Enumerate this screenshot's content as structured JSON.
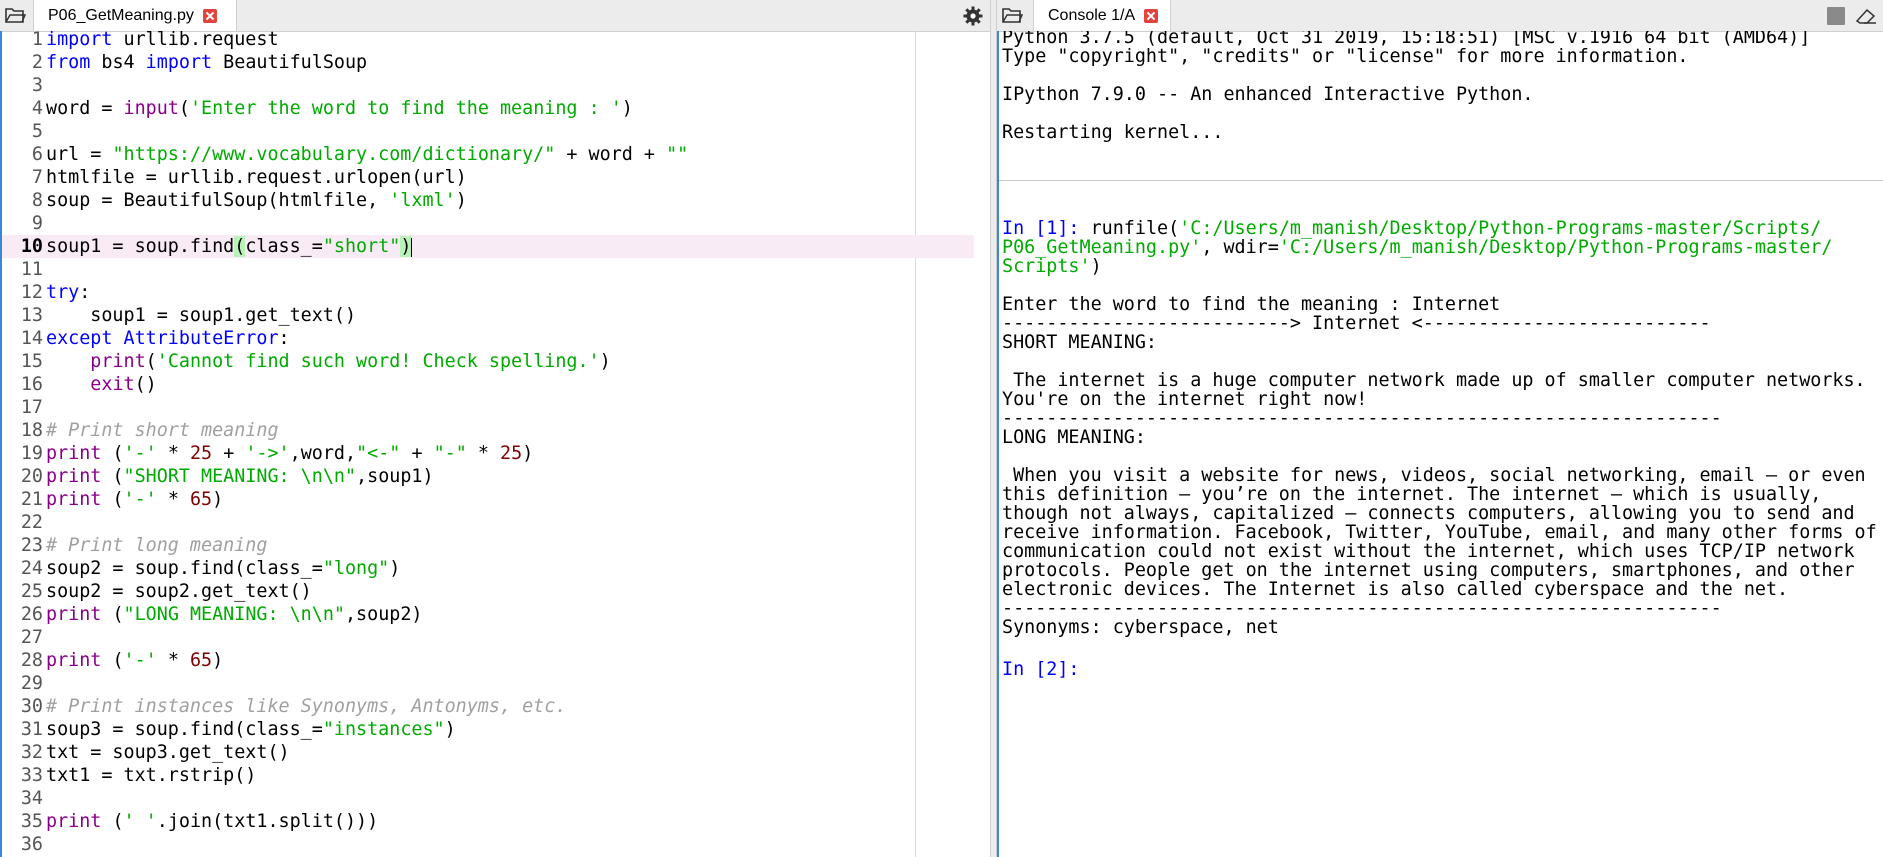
{
  "editor": {
    "tab_label": "P06_GetMeaning.py",
    "current_line": 10,
    "lines": [
      {
        "n": "1"
      },
      {
        "n": "2"
      },
      {
        "n": "3"
      },
      {
        "n": "4"
      },
      {
        "n": "5"
      },
      {
        "n": "6"
      },
      {
        "n": "7"
      },
      {
        "n": "8"
      },
      {
        "n": "9"
      },
      {
        "n": "10"
      },
      {
        "n": "11"
      },
      {
        "n": "12"
      },
      {
        "n": "13"
      },
      {
        "n": "14"
      },
      {
        "n": "15"
      },
      {
        "n": "16"
      },
      {
        "n": "17"
      },
      {
        "n": "18"
      },
      {
        "n": "19"
      },
      {
        "n": "20"
      },
      {
        "n": "21"
      },
      {
        "n": "22"
      },
      {
        "n": "23"
      },
      {
        "n": "24"
      },
      {
        "n": "25"
      },
      {
        "n": "26"
      },
      {
        "n": "27"
      },
      {
        "n": "28"
      },
      {
        "n": "29"
      },
      {
        "n": "30"
      },
      {
        "n": "31"
      },
      {
        "n": "32"
      },
      {
        "n": "33"
      },
      {
        "n": "34"
      },
      {
        "n": "35"
      },
      {
        "n": "36"
      }
    ],
    "code": {
      "l1": [
        "import",
        " urllib.request"
      ],
      "l2": [
        "from",
        " bs4 ",
        "import",
        " BeautifulSoup"
      ],
      "l4": [
        "word = ",
        "input",
        "(",
        "'Enter the word to find the meaning : '",
        ")"
      ],
      "l6": [
        "url = ",
        "\"https://www.vocabulary.com/dictionary/\"",
        " + word + ",
        "\"\""
      ],
      "l7": [
        "htmlfile = urllib.request.urlopen(url)"
      ],
      "l8": [
        "soup = BeautifulSoup(htmlfile, ",
        "'lxml'",
        ")"
      ],
      "l10": [
        "soup1 = soup.find",
        "(",
        "class_=",
        "\"short\"",
        ")"
      ],
      "l12": [
        "try",
        ":"
      ],
      "l13": [
        "    soup1 = soup1.get_text()"
      ],
      "l14": [
        "except",
        " ",
        "AttributeError",
        ":"
      ],
      "l15": [
        "    ",
        "print",
        "(",
        "'Cannot find such word! Check spelling.'",
        ")"
      ],
      "l16": [
        "    ",
        "exit",
        "()"
      ],
      "l18": [
        "# Print short meaning"
      ],
      "l19": [
        "print",
        " (",
        "'-'",
        " * ",
        "25",
        " + ",
        "'->'",
        ",word,",
        "\"<-\"",
        " + ",
        "\"-\"",
        " * ",
        "25",
        ")"
      ],
      "l20": [
        "print",
        " (",
        "\"SHORT MEANING: \\n\\n\"",
        ",soup1)"
      ],
      "l21": [
        "print",
        " (",
        "'-'",
        " * ",
        "65",
        ")"
      ],
      "l23": [
        "# Print long meaning"
      ],
      "l24": [
        "soup2 = soup.find(class_=",
        "\"long\"",
        ")"
      ],
      "l25": [
        "soup2 = soup2.get_text()"
      ],
      "l26": [
        "print",
        " (",
        "\"LONG MEANING: \\n\\n\"",
        ",soup2)"
      ],
      "l28": [
        "print",
        " (",
        "'-'",
        " * ",
        "65",
        ")"
      ],
      "l30": [
        "# Print instances like Synonyms, Antonyms, etc."
      ],
      "l31": [
        "soup3 = soup.find(class_=",
        "\"instances\"",
        ")"
      ],
      "l32": [
        "txt = soup3.get_text()"
      ],
      "l33": [
        "txt1 = txt.rstrip()"
      ],
      "l35": [
        "print",
        " (",
        "' '",
        ".join(txt1.split()))"
      ]
    }
  },
  "console": {
    "tab_label": "Console 1/A",
    "banner": [
      "Python 3.7.5 (default, Oct 31 2019, 15:18:51) [MSC v.1916 64 bit (AMD64)]",
      "Type \"copyright\", \"credits\" or \"license\" for more information.",
      "IPython 7.9.0 -- An enhanced Interactive Python.",
      "Restarting kernel..."
    ],
    "in1_prompt": "In [1]:",
    "runfile": [
      " runfile(",
      "'C:/Users/m_manish/Desktop/Python-Programs-master/Scripts/",
      "P06_GetMeaning.py'",
      ", wdir=",
      "'C:/Users/m_manish/Desktop/Python-Programs-master/",
      "Scripts'",
      ")"
    ],
    "output": [
      "Enter the word to find the meaning : Internet",
      "--------------------------> Internet <--------------------------",
      "SHORT MEANING:",
      " The internet is a huge computer network made up of smaller computer networks.",
      "You're on the internet right now!",
      "-----------------------------------------------------------------",
      "LONG MEANING:",
      " When you visit a website for news, videos, social networking, email — or even",
      "this definition — you’re on the internet. The internet — which is usually,",
      "though not always, capitalized — connects computers, allowing you to send and",
      "receive information. Facebook, Twitter, YouTube, email, and many other forms of",
      "communication could not exist without the internet, which uses TCP/IP network",
      "protocols. People get on the internet using computers, smartphones, and other",
      "electronic devices. The Internet is also called cyberspace and the net.",
      "-----------------------------------------------------------------",
      "Synonyms: cyberspace, net"
    ],
    "in2_prompt": "In [2]:"
  },
  "icons": {
    "editor_browse": "folder-icon",
    "editor_options": "gear-icon",
    "console_browse": "folder-icon",
    "console_stop": "stop-icon",
    "console_clear": "eraser-icon"
  },
  "colors": {
    "keyword": "#0000ff",
    "builtin": "#8b008b",
    "string": "#00aa00",
    "number": "#800000",
    "comment": "#a0a0a0",
    "current_line": "#f8ebf6",
    "bracket_match": "#b9f3b9",
    "close_icon": "#e0443c",
    "focus_border": "#3a87d8"
  }
}
